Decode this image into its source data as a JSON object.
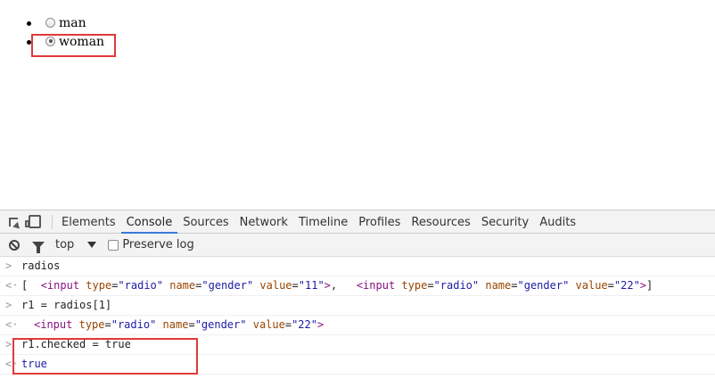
{
  "page": {
    "radios": [
      {
        "label": "man",
        "checked": false
      },
      {
        "label": "woman",
        "checked": true
      }
    ]
  },
  "devtools": {
    "tabs": [
      "Elements",
      "Console",
      "Sources",
      "Network",
      "Timeline",
      "Profiles",
      "Resources",
      "Security",
      "Audits"
    ],
    "active_tab": "Console",
    "console_toolbar": {
      "context": "top",
      "preserve_log_label": "Preserve log"
    },
    "log": {
      "line1_input": "radios",
      "line2": {
        "open": "[",
        "tag": "input",
        "type_attr": "type",
        "type_val": "\"radio\"",
        "name_attr": "name",
        "name_val": "\"gender\"",
        "value_attr": "value",
        "value1": "\"11\"",
        "value2": "\"22\"",
        "close": "]"
      },
      "line3_input": "r1 = radios[1]",
      "line5_input": "r1.checked = true",
      "line6_output": "true"
    }
  }
}
